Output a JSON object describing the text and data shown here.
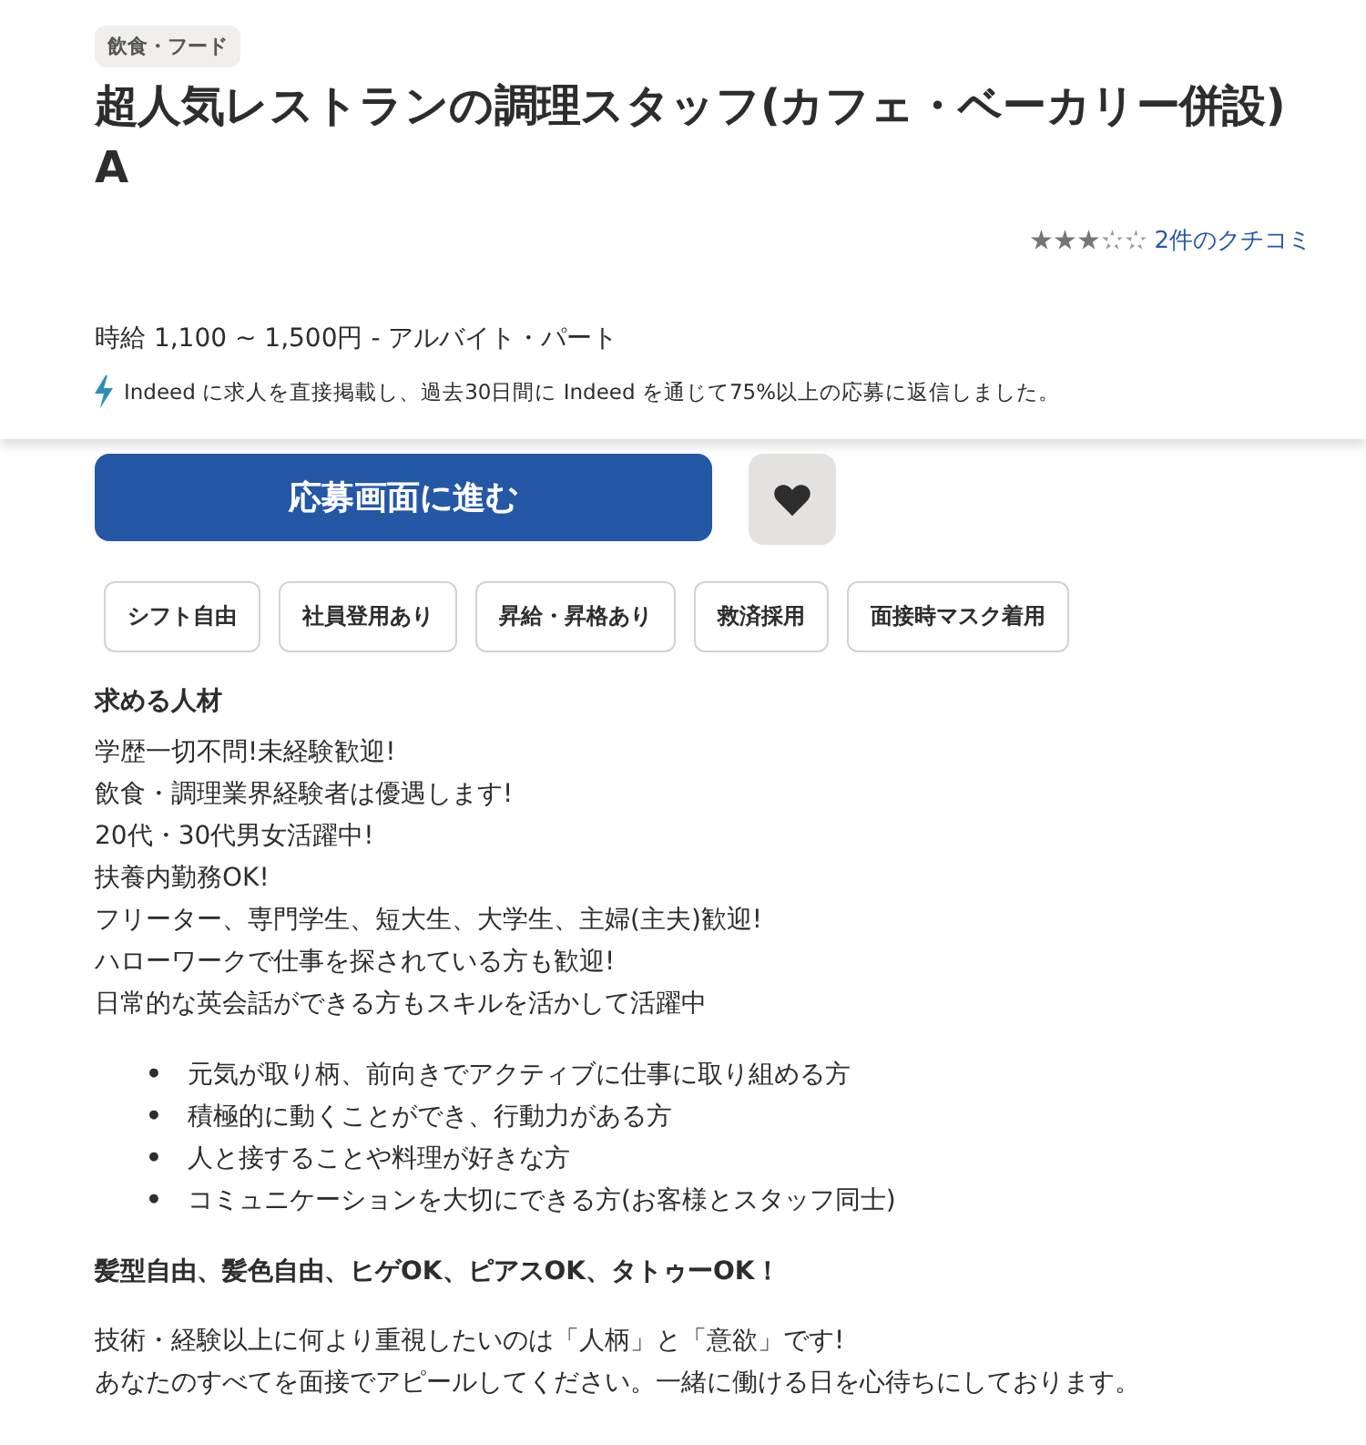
{
  "category": "飲食・フード",
  "title": "超人気レストランの調理スタッフ(カフェ・ベーカリー併設) A",
  "rating": {
    "stars": 3,
    "reviews_link": "2件のクチコミ"
  },
  "salary": "時給 1,100 ~ 1,500円  - アルバイト・パート",
  "responsive_note": "Indeed に求人を直接掲載し、過去30日間に Indeed を通じて75%以上の応募に返信しました。",
  "apply_button": "応募画面に進む",
  "tags": [
    "シフト自由",
    "社員登用あり",
    "昇給・昇格あり",
    "救済採用",
    "面接時マスク着用"
  ],
  "section_heading": "求める人材",
  "intro_lines": [
    "学歴一切不問!未経験歓迎!",
    "飲食・調理業界経験者は優遇します!",
    "20代・30代男女活躍中!",
    "扶養内勤務OK!",
    "フリーター、専門学生、短大生、大学生、主婦(主夫)歓迎!",
    "ハローワークで仕事を探されている方も歓迎!",
    "日常的な英会話ができる方もスキルを活かして活躍中"
  ],
  "bullets": [
    {
      "marker": "•",
      "text": "元気が取り柄、前向きでアクティブに仕事に取り組める方"
    },
    {
      "marker": "•",
      "text": "積極的に動くことができ、行動力がある方"
    },
    {
      "marker": "•",
      "text": "人と接することや料理が好きな方"
    },
    {
      "marker": "•",
      "text": "コミュニケーションを大切にできる方(お客様とスタッフ同士)"
    }
  ],
  "bold_line": "髪型自由、髪色自由、ヒゲOK、ピアスOK、タトゥーOK！",
  "closing_lines": [
    "技術・経験以上に何より重視したいのは「人柄」と「意欲」です!",
    "あなたのすべてを面接でアピールしてください。一緒に働ける日を心待ちにしております。"
  ]
}
